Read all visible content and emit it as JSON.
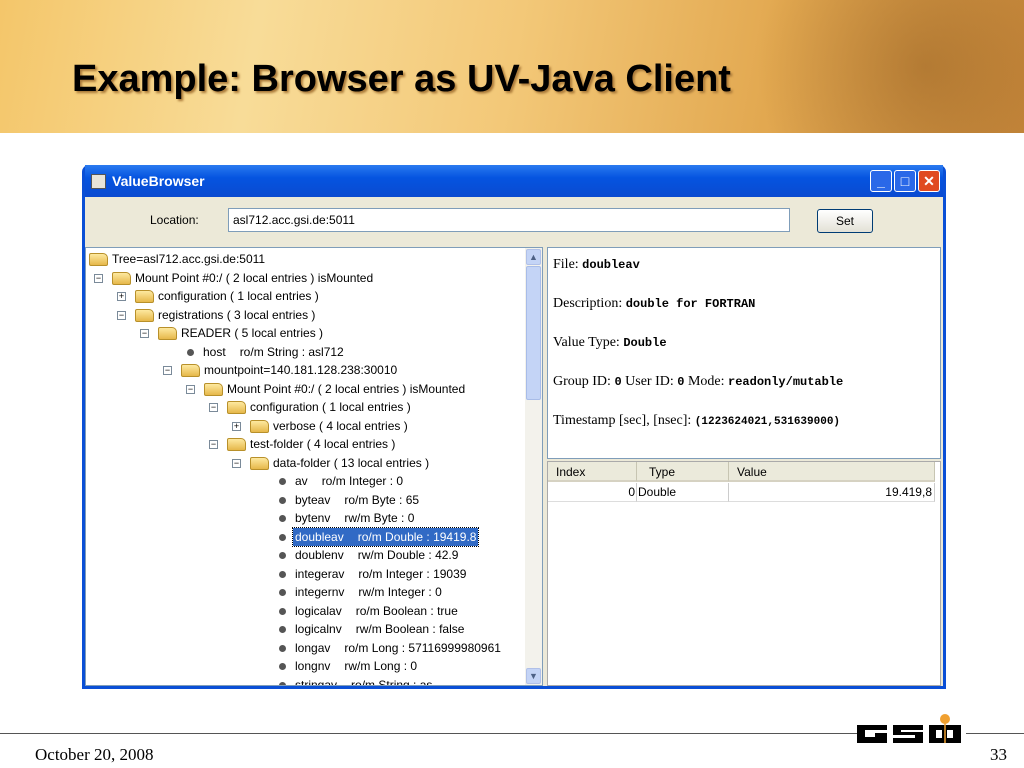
{
  "slide": {
    "title": "Example: Browser as UV-Java Client",
    "date": "October 20, 2008",
    "page": "33",
    "logo_text": "GSI"
  },
  "window": {
    "title": "ValueBrowser",
    "minimize": "_",
    "maximize": "□",
    "close": "✕"
  },
  "location": {
    "label": "Location:",
    "value": "asl712.acc.gsi.de:5011",
    "set_label": "Set"
  },
  "tree": [
    {
      "depth": 0,
      "toggle": "",
      "kind": "folder",
      "name": "Tree=asl712.acc.gsi.de:5011",
      "detail": ""
    },
    {
      "depth": 1,
      "toggle": "-",
      "kind": "folder",
      "name": "Mount Point #0:/ ( 2 local entries ) isMounted",
      "detail": ""
    },
    {
      "depth": 2,
      "toggle": "+",
      "kind": "folder",
      "name": "configuration ( 1 local entries )",
      "detail": ""
    },
    {
      "depth": 2,
      "toggle": "-",
      "kind": "folder",
      "name": "registrations ( 3 local entries )",
      "detail": ""
    },
    {
      "depth": 3,
      "toggle": "-",
      "kind": "folder",
      "name": "READER ( 5 local entries )",
      "detail": ""
    },
    {
      "depth": 4,
      "toggle": "",
      "kind": "leaf",
      "name": "host",
      "detail": "ro/m String : asl712"
    },
    {
      "depth": 4,
      "toggle": "-",
      "kind": "folder",
      "name": "mountpoint=140.181.128.238:30010",
      "detail": ""
    },
    {
      "depth": 5,
      "toggle": "-",
      "kind": "folder",
      "name": "Mount Point #0:/ ( 2 local entries ) isMounted",
      "detail": ""
    },
    {
      "depth": 6,
      "toggle": "-",
      "kind": "folder",
      "name": "configuration ( 1 local entries )",
      "detail": ""
    },
    {
      "depth": 7,
      "toggle": "+",
      "kind": "folder",
      "name": "verbose ( 4 local entries )",
      "detail": ""
    },
    {
      "depth": 6,
      "toggle": "-",
      "kind": "folder",
      "name": "test-folder ( 4 local entries )",
      "detail": ""
    },
    {
      "depth": 7,
      "toggle": "-",
      "kind": "folder",
      "name": "data-folder ( 13 local entries )",
      "detail": ""
    },
    {
      "depth": 8,
      "toggle": "",
      "kind": "leaf",
      "name": "av",
      "detail": "ro/m Integer : 0"
    },
    {
      "depth": 8,
      "toggle": "",
      "kind": "leaf",
      "name": "byteav",
      "detail": "ro/m Byte : 65"
    },
    {
      "depth": 8,
      "toggle": "",
      "kind": "leaf",
      "name": "bytenv",
      "detail": "rw/m Byte : 0"
    },
    {
      "depth": 8,
      "toggle": "",
      "kind": "leaf",
      "name": "doubleav",
      "detail": "ro/m Double : 19419.8",
      "selected": true
    },
    {
      "depth": 8,
      "toggle": "",
      "kind": "leaf",
      "name": "doublenv",
      "detail": "rw/m Double : 42.9"
    },
    {
      "depth": 8,
      "toggle": "",
      "kind": "leaf",
      "name": "integerav",
      "detail": "ro/m Integer : 19039"
    },
    {
      "depth": 8,
      "toggle": "",
      "kind": "leaf",
      "name": "integernv",
      "detail": "rw/m Integer : 0"
    },
    {
      "depth": 8,
      "toggle": "",
      "kind": "leaf",
      "name": "logicalav",
      "detail": "ro/m Boolean : true"
    },
    {
      "depth": 8,
      "toggle": "",
      "kind": "leaf",
      "name": "logicalnv",
      "detail": "rw/m Boolean : false"
    },
    {
      "depth": 8,
      "toggle": "",
      "kind": "leaf",
      "name": "longav",
      "detail": "ro/m Long : 57116999980961"
    },
    {
      "depth": 8,
      "toggle": "",
      "kind": "leaf",
      "name": "longnv",
      "detail": "rw/m Long : 0"
    },
    {
      "depth": 8,
      "toggle": "",
      "kind": "leaf",
      "name": "stringav",
      "detail": "ro/m String : as"
    }
  ],
  "detail": {
    "file_label": "File:",
    "file": "doubleav",
    "desc_label": "Description:",
    "desc": "double for FORTRAN",
    "type_label": "Value Type:",
    "type": "Double",
    "group_label": "Group ID:",
    "group": "0",
    "user_label": "User ID:",
    "user": "0",
    "mode_label": "Mode:",
    "mode": "readonly/mutable",
    "ts_label": "Timestamp [sec], [nsec]:",
    "ts": "(1223624021,531639000)"
  },
  "table": {
    "headers": [
      "Index",
      "Type",
      "Value"
    ],
    "rows": [
      [
        "0",
        "Double",
        "19.419,8"
      ]
    ]
  }
}
